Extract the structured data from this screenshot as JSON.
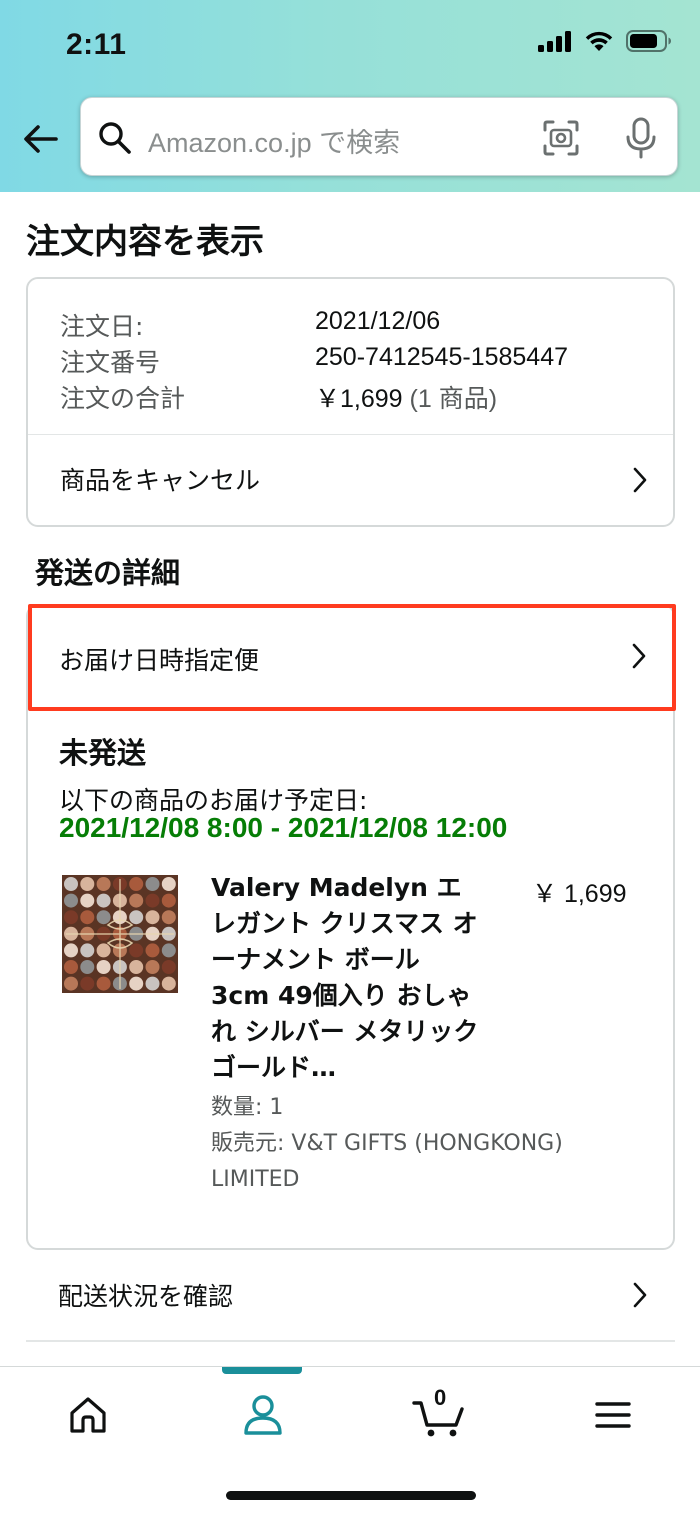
{
  "status_bar": {
    "time": "2:11"
  },
  "search": {
    "placeholder": "Amazon.co.jp で検索"
  },
  "page": {
    "title": "注文内容を表示"
  },
  "order_summary": {
    "date_label": "注文日:",
    "date_value": "2021/12/06",
    "number_label": "注文番号",
    "number_value": "250-7412545-1585447",
    "total_label": "注文の合計",
    "total_value": "￥1,699",
    "total_items": "(1 商品)",
    "cancel_label": "商品をキャンセル"
  },
  "shipment": {
    "section_title": "発送の詳細",
    "method_label": "お届け日時指定便",
    "status": "未発送",
    "delivery_label": "以下の商品のお届け予定日:",
    "delivery_window": "2021/12/08 8:00 - 2021/12/08 12:00",
    "highlight_color": "#ff3b1f",
    "delivery_color": "#067d06"
  },
  "product": {
    "title": "Valery Madelyn エレガント クリスマス オーナメント ボール 3cm 49個入り おしゃれ シルバー メタリックゴールド…",
    "price": "￥ 1,699",
    "quantity": "数量: 1",
    "seller": "販売元: V&T GIFTS (HONGKONG)",
    "seller_line2": "LIMITED",
    "image": "ornament-box-image"
  },
  "tracking": {
    "label": "配送状況を確認"
  },
  "bottom_nav": {
    "items": [
      "home-icon",
      "account-icon",
      "cart-icon",
      "menu-icon"
    ],
    "active": "account-icon",
    "cart_count": "0",
    "accent_color": "#1a8f9a"
  }
}
